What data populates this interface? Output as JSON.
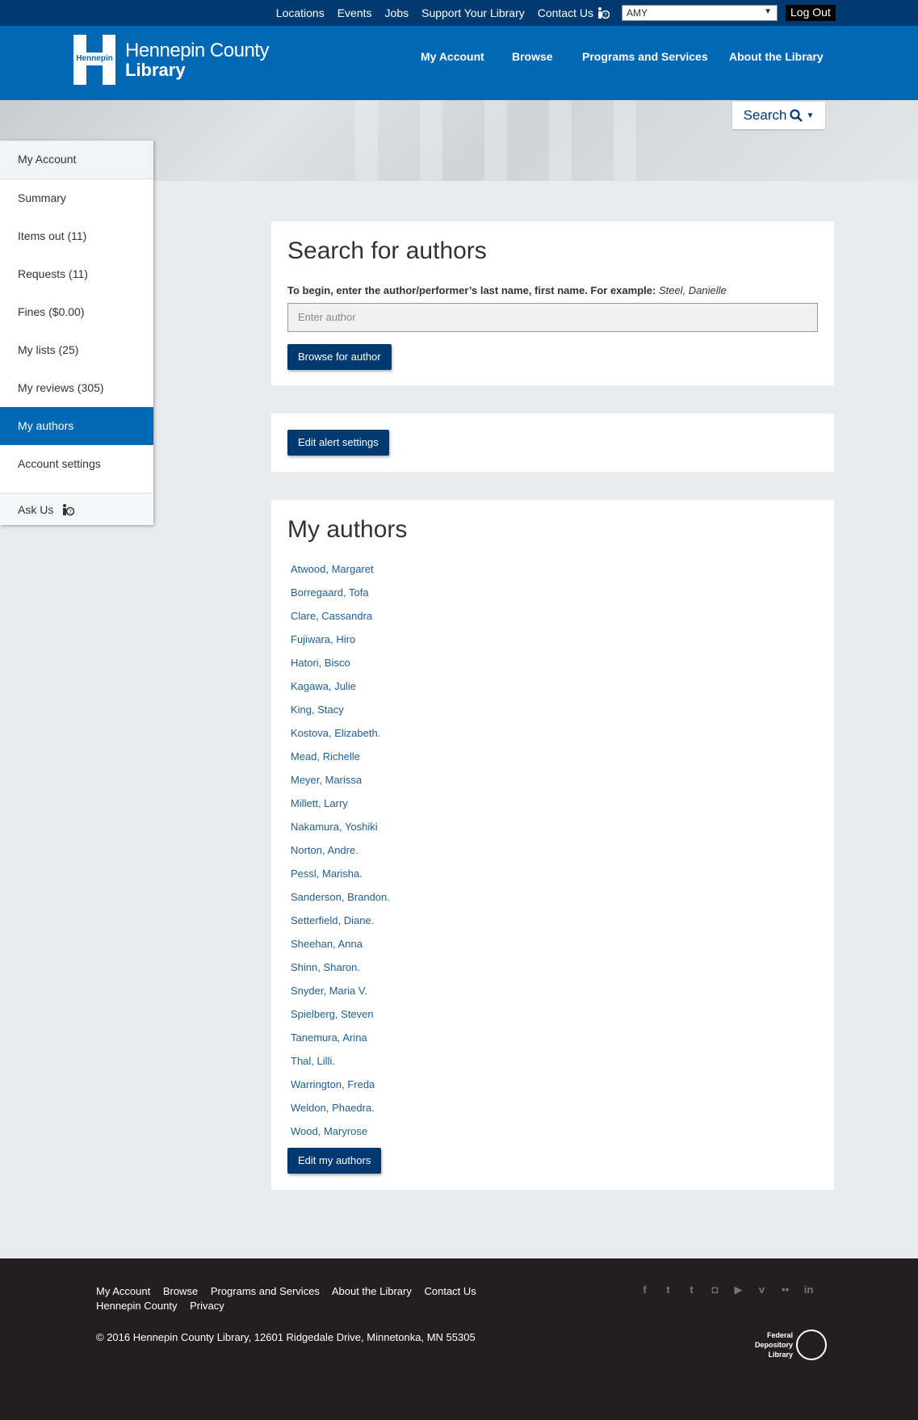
{
  "utility": {
    "links": [
      "Locations",
      "Events",
      "Jobs",
      "Support Your Library",
      "Contact Us"
    ],
    "user_select": "AMY",
    "logout": "Log Out"
  },
  "logo": {
    "mark": "Hennepin",
    "line1": "Hennepin County",
    "line2": "Library"
  },
  "mainnav": [
    "My Account",
    "Browse",
    "Programs and Services",
    "About the Library"
  ],
  "search_button": "Search",
  "sidebar": {
    "header": "My Account",
    "items": [
      "Summary",
      "Items out (11)",
      "Requests (11)",
      "Fines ($0.00)",
      "My lists (25)",
      "My reviews (305)",
      "My authors",
      "Account settings"
    ],
    "active": "My authors",
    "ask_us": "Ask Us"
  },
  "search_panel": {
    "title": "Search for authors",
    "hint": "To begin, enter the author/performer’s last name, first name. For example:",
    "example": "Steel, Danielle",
    "placeholder": "Enter author",
    "button": "Browse for author"
  },
  "alert_panel": {
    "button": "Edit alert settings"
  },
  "authors_panel": {
    "title": "My authors",
    "authors": [
      "Atwood, Margaret",
      "Borregaard, Tofa",
      "Clare, Cassandra",
      "Fujiwara, Hiro",
      "Hatori, Bisco",
      "Kagawa, Julie",
      "King, Stacy",
      "Kostova, Elizabeth.",
      "Mead, Richelle",
      "Meyer, Marissa",
      "Millett, Larry",
      "Nakamura, Yoshiki",
      "Norton, Andre.",
      "Pessl, Marisha.",
      "Sanderson, Brandon.",
      "Setterfield, Diane.",
      "Sheehan, Anna",
      "Shinn, Sharon.",
      "Snyder, Maria V.",
      "Spielberg, Steven",
      "Tanemura, Arina",
      "Thal, Lilli.",
      "Warrington, Freda",
      "Weldon, Phaedra.",
      "Wood, Maryrose"
    ],
    "button": "Edit my authors"
  },
  "footer": {
    "links": [
      "My Account",
      "Browse",
      "Programs and Services",
      "About the Library",
      "Contact Us",
      "Hennepin County",
      "Privacy"
    ],
    "copyright": "© 2016 Hennepin County Library, 12601 Ridgedale Drive, Minnetonka, MN 55305",
    "social_icons": [
      "facebook-icon",
      "twitter-icon",
      "tumblr-icon",
      "instagram-icon",
      "youtube-icon",
      "vimeo-icon",
      "flickr-icon",
      "linkedin-icon"
    ],
    "fdl_line1": "Federal",
    "fdl_line2": "Depository",
    "fdl_line3": "Library"
  },
  "colors": {
    "navy": "#003a70",
    "brand_blue": "#0068b4",
    "link": "#1f5d96",
    "footer_bg": "#231f20"
  }
}
